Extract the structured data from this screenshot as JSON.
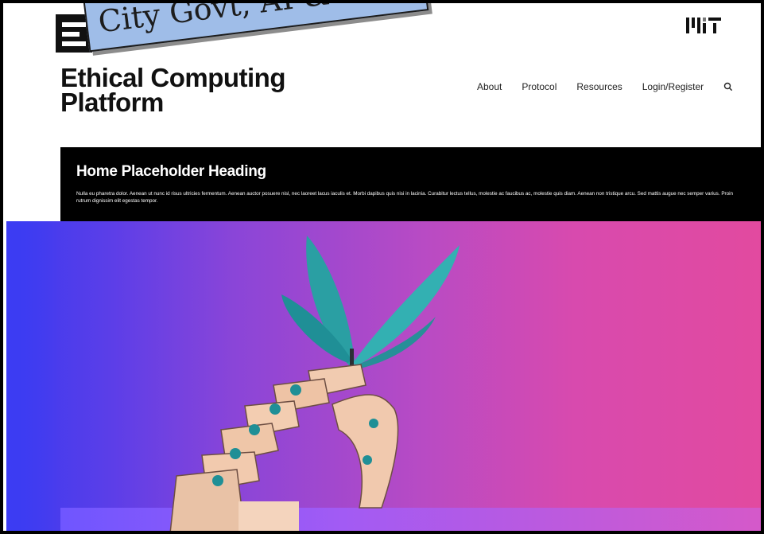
{
  "sticker": {
    "text": "City Govt, AI & Ro"
  },
  "header": {
    "title_line1": "Ethical Computing",
    "title_line2": "Platform",
    "brand_logo": "mit-logo"
  },
  "nav": {
    "items": [
      {
        "label": "About"
      },
      {
        "label": "Protocol"
      },
      {
        "label": "Resources"
      },
      {
        "label": "Login/Register"
      }
    ],
    "search_icon": "search-icon"
  },
  "hero": {
    "heading": "Home Placeholder Heading",
    "body": "Nulla eu pharetra dolor. Aenean ut nunc id risus ultricies fermentum. Aenean auctor posuere nisl, nec laoreet lacus iaculis et. Morbi dapibus quis nisi in lacinia. Curabitur lectus tellus, molestie ac faucibus ac, molestie quis diam. Aenean non tristique arcu. Sed mattis augue nec semper varius. Proin rutrum dignissim elit egestas tempor.",
    "image": "robot-hand-with-butterfly"
  },
  "colors": {
    "hero_band": "#000000",
    "gradient_left": "#3a3bf0",
    "gradient_right": "#e24a9f",
    "sticker_fill": "#9fbde8"
  }
}
